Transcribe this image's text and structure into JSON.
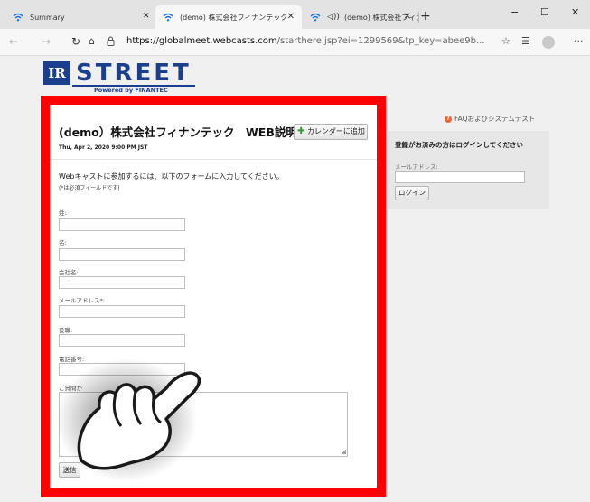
{
  "browser": {
    "tabs": [
      {
        "label": "Summary",
        "active": false
      },
      {
        "label": "(demo) 株式会社フィナンテック",
        "active": true
      },
      {
        "label": "(demo) 株式会社フィナンテ",
        "active": false
      }
    ],
    "new_tab": "+",
    "window_controls": {
      "minimize": "−",
      "maximize": "☐",
      "close": "✕"
    },
    "url_domain": "https://globalmeet.webcasts.com",
    "url_path": "/starthere.jsp?ei=1299569&tp_key=abee9b...",
    "icons": {
      "back": "back-arrow-icon",
      "forward": "forward-arrow-icon",
      "refresh": "refresh-icon",
      "home": "home-icon",
      "lock": "lock-icon",
      "favorite": "star-icon",
      "collections": "favorites-bar-icon",
      "profile": "profile-icon",
      "more": "more-icon"
    }
  },
  "logo": {
    "mark": "IR",
    "name": "STREET",
    "powered_by": "Powered by FINANTEC"
  },
  "event": {
    "title": "(demo）株式会社フィナンテック　WEB説明会案内",
    "calendar_button": "カレンダーに追加",
    "date": "Thu, Apr 2, 2020 9:00 PM JST"
  },
  "form": {
    "intro": "Webキャストに参加するには、以下のフォームに入力してください。",
    "required_note": "(*は必須フィールドです)",
    "fields": [
      {
        "label": "姓:",
        "value": ""
      },
      {
        "label": "名:",
        "value": ""
      },
      {
        "label": "会社名:",
        "value": ""
      },
      {
        "label": "メールアドレス*:",
        "value": ""
      },
      {
        "label": "役職:",
        "value": ""
      },
      {
        "label": "電話番号:",
        "value": ""
      }
    ],
    "question_label": "ご質問か",
    "submit": "送信"
  },
  "login": {
    "faq_link": "FAQおよびシステムテスト",
    "title": "登録がお済みの方はログインしてください",
    "email_label": "メールアドレス:",
    "email_value": "",
    "button": "ログイン"
  },
  "colors": {
    "highlight_frame": "#ff0000",
    "brand_blue": "#1a3f8e",
    "faq_icon": "#e8663a"
  },
  "overlay": {
    "icon": "pointing-hand-icon"
  }
}
